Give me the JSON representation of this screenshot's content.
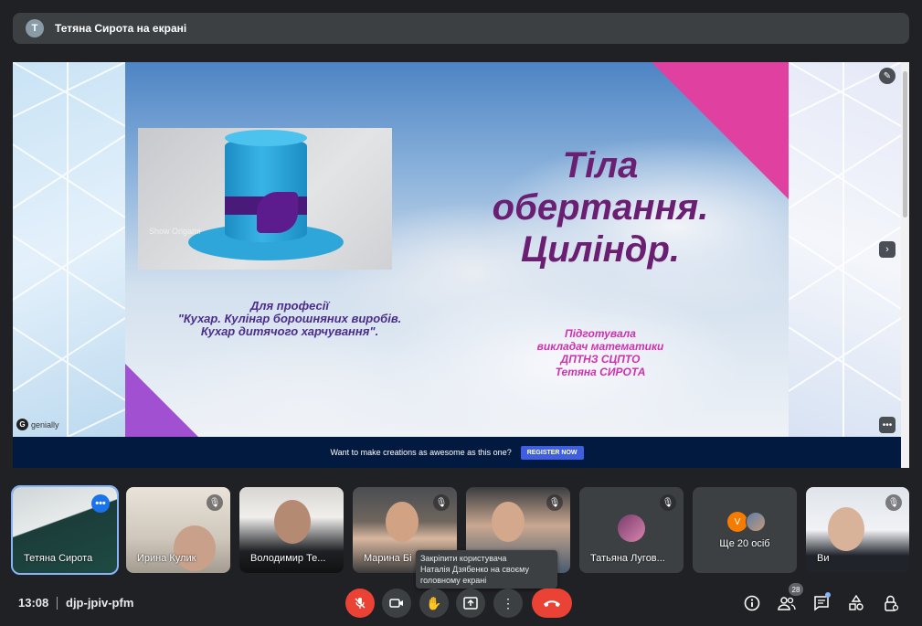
{
  "topbar": {
    "avatar_letter": "T",
    "title": "Тетяна Сирота на екрані"
  },
  "slide": {
    "heading_lines": [
      "Тіла",
      "обертання.",
      "Циліндр."
    ],
    "profession_lines": [
      "Для професії",
      "\"Кухар. Кулінар борошняних виробів.",
      "Кухар дитячого харчування\"."
    ],
    "author_lines": [
      "Підготувала",
      "викладач математики",
      "ДПТНЗ СЦПТО",
      "Тетяна СИРОТА"
    ],
    "photo_watermark": "Show Origami",
    "brand": "genially",
    "promo_text": "Want to make creations as awesome as this one?",
    "register_label": "REGISTER NOW",
    "colors": {
      "pink": "#e040a0",
      "purple": "#a050d0",
      "heading": "#6b1f72"
    }
  },
  "participants": [
    {
      "name": "Тетяна Сирота",
      "active": true
    },
    {
      "name": "Ирина Кулик"
    },
    {
      "name": "Володимир Те..."
    },
    {
      "name": "Марина Бі"
    },
    {
      "name": ""
    },
    {
      "name": "Татьяна Лугов..."
    },
    {
      "name": "Ще 20 осіб",
      "avatar_letter": "V"
    },
    {
      "name": "Ви"
    }
  ],
  "tooltip": {
    "lines": [
      "Закріпити користувача",
      "Наталія Дзябенко на своєму",
      "головному екрані"
    ]
  },
  "bottom": {
    "time": "13:08",
    "meeting_code": "djp-jpiv-pfm",
    "participants_count": "28",
    "icons": {
      "mic": "mic-off-icon",
      "camera": "camera-icon",
      "hand": "raise-hand-icon",
      "present": "present-icon",
      "more": "more-vert-icon",
      "hangup": "call-end-icon",
      "info": "info-icon",
      "people": "people-icon",
      "chat": "chat-icon",
      "activities": "activities-icon",
      "lock": "host-controls-icon"
    }
  }
}
